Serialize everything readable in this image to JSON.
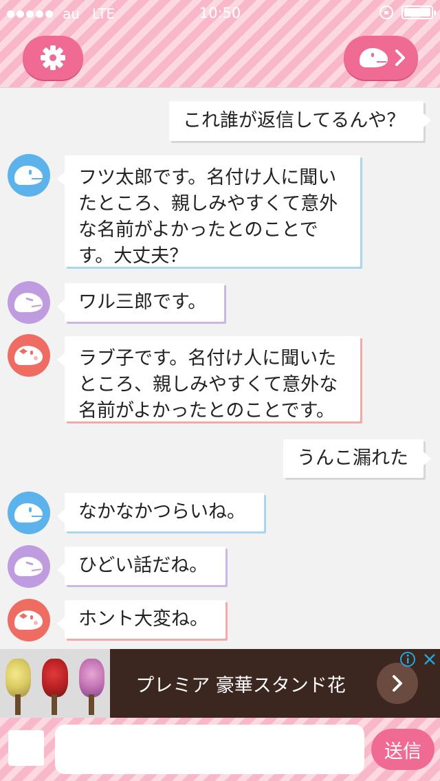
{
  "status_bar": {
    "carrier": "au",
    "network": "LTE",
    "time": "10:50"
  },
  "header": {
    "settings_icon": "gear-icon",
    "character_icon": "character-face-icon"
  },
  "messages": [
    {
      "side": "right",
      "text": "これ誰が返信してるんや？"
    },
    {
      "side": "left",
      "avatar": "blue",
      "text": "フツ太郎です。名付け人に聞いたところ、親しみやすくて意外な名前がよかったとのことです。大丈夫？"
    },
    {
      "side": "left",
      "avatar": "purple",
      "text": "ワル三郎です。"
    },
    {
      "side": "left",
      "avatar": "red",
      "text": "ラブ子です。名付け人に聞いたところ、親しみやすくて意外な名前がよかったとのことです。"
    },
    {
      "side": "right",
      "text": "うんこ漏れた"
    },
    {
      "side": "left",
      "avatar": "blue",
      "text": "なかなかつらいね。"
    },
    {
      "side": "left",
      "avatar": "purple",
      "text": "ひどい話だね。"
    },
    {
      "side": "left",
      "avatar": "red",
      "text": "ホント大変ね。"
    }
  ],
  "ad": {
    "text": "プレミア 豪華スタンド花",
    "info_icon": "info-icon",
    "close_icon": "close-icon"
  },
  "input": {
    "placeholder": "",
    "send_label": "送信"
  },
  "colors": {
    "accent": "#f06b94",
    "blue": "#5cb3ec",
    "purple": "#bf9be0",
    "red": "#ee6c62"
  }
}
